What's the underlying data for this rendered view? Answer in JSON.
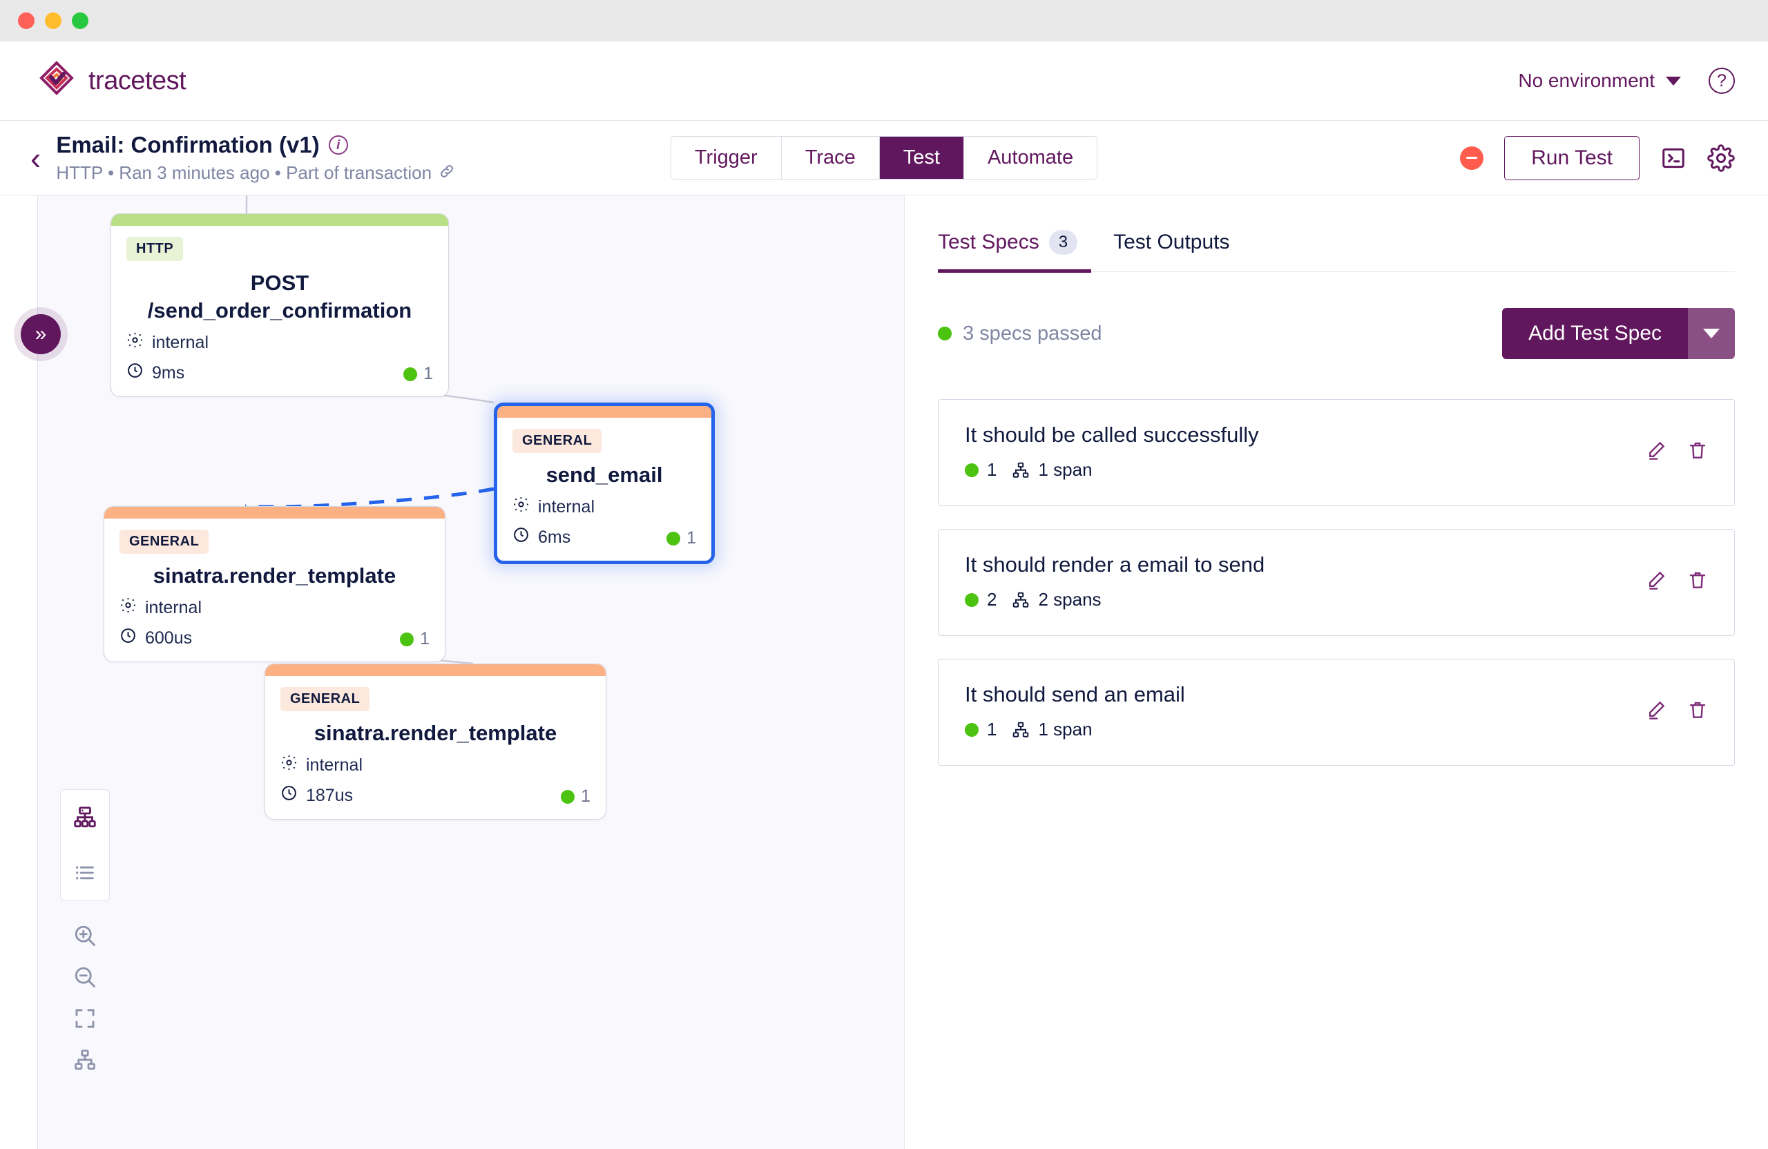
{
  "window": {
    "traffic_lights": [
      "close",
      "minimize",
      "maximize"
    ]
  },
  "brand": {
    "name": "tracetest",
    "logo_icon": "tracetest-diamond-logo"
  },
  "topbar": {
    "environment_label": "No environment",
    "environment_caret_icon": "chevron-down-icon",
    "help_icon": "help-circle-icon",
    "help_label": "?"
  },
  "subheader": {
    "back_icon": "chevron-left-icon",
    "title": "Email: Confirmation (v1)",
    "info_icon": "info-circle-icon",
    "info_label": "i",
    "meta": "HTTP • Ran 3 minutes ago • Part of transaction",
    "link_icon": "external-link-icon",
    "link_glyph": "🔗",
    "tabs": [
      {
        "label": "Trigger",
        "active": false
      },
      {
        "label": "Trace",
        "active": false
      },
      {
        "label": "Test",
        "active": true
      },
      {
        "label": "Automate",
        "active": false
      }
    ],
    "status_icon": "status-failed-icon",
    "run_button": "Run Test",
    "cli_icon": "terminal-icon",
    "settings_icon": "gear-icon"
  },
  "canvas": {
    "collapse_button_icon": "chevrons-right-icon",
    "collapse_button_glyph": "»",
    "tools": [
      {
        "name": "graph-view-icon",
        "active": true
      },
      {
        "name": "list-view-icon",
        "active": false
      },
      {
        "name": "zoom-in-icon",
        "active": false
      },
      {
        "name": "zoom-out-icon",
        "active": false
      },
      {
        "name": "fit-view-icon",
        "active": false
      },
      {
        "name": "layout-tree-icon",
        "active": false
      }
    ],
    "nodes": [
      {
        "id": "post-send-order-confirmation",
        "badge": "HTTP",
        "badge_bg": "#e8f3d6",
        "strip_color": "#b8de86",
        "name_line1": "POST",
        "name_line2": "/send_order_confirmation",
        "kind_icon": "gear-icon",
        "kind": "internal",
        "duration_icon": "clock-icon",
        "duration": "9ms",
        "count": "1",
        "selected": false
      },
      {
        "id": "send-email",
        "badge": "GENERAL",
        "badge_bg": "#fce8dc",
        "strip_color": "#fbb184",
        "name_line1": "send_email",
        "name_line2": "",
        "kind_icon": "gear-icon",
        "kind": "internal",
        "duration_icon": "clock-icon",
        "duration": "6ms",
        "count": "1",
        "selected": true
      },
      {
        "id": "sinatra-render-template-1",
        "badge": "GENERAL",
        "badge_bg": "#fce8dc",
        "strip_color": "#fbb184",
        "name_line1": "sinatra.render_template",
        "name_line2": "",
        "kind_icon": "gear-icon",
        "kind": "internal",
        "duration_icon": "clock-icon",
        "duration": "600us",
        "count": "1",
        "selected": false
      },
      {
        "id": "sinatra-render-template-2",
        "badge": "GENERAL",
        "badge_bg": "#fce8dc",
        "strip_color": "#fbb184",
        "name_line1": "sinatra.render_template",
        "name_line2": "",
        "kind_icon": "gear-icon",
        "kind": "internal",
        "duration_icon": "clock-icon",
        "duration": "187us",
        "count": "1",
        "selected": false
      }
    ]
  },
  "panel": {
    "tabs": [
      {
        "label": "Test Specs",
        "count": "3",
        "active": true
      },
      {
        "label": "Test Outputs",
        "count": "",
        "active": false
      }
    ],
    "status_text": "3 specs passed",
    "add_spec_label": "Add Test Spec",
    "add_spec_caret_icon": "caret-down-icon",
    "specs": [
      {
        "title": "It should be called successfully",
        "assertions": "1",
        "spans_icon": "spans-tree-icon",
        "spans": "1 span",
        "edit_icon": "pencil-icon",
        "delete_icon": "trash-icon"
      },
      {
        "title": "It should render a email to send",
        "assertions": "2",
        "spans_icon": "spans-tree-icon",
        "spans": "2 spans",
        "edit_icon": "pencil-icon",
        "delete_icon": "trash-icon"
      },
      {
        "title": "It should send an email",
        "assertions": "1",
        "spans_icon": "spans-tree-icon",
        "spans": "1 span",
        "edit_icon": "pencil-icon",
        "delete_icon": "trash-icon"
      }
    ]
  },
  "colors": {
    "brand_purple": "#61175e",
    "accent_blue": "#2563eb",
    "pass_green": "#4cc211",
    "fail_red": "#ff5c4d",
    "http_strip": "#b8de86",
    "general_strip": "#fbb184",
    "canvas_bg": "#f8f8fd"
  }
}
